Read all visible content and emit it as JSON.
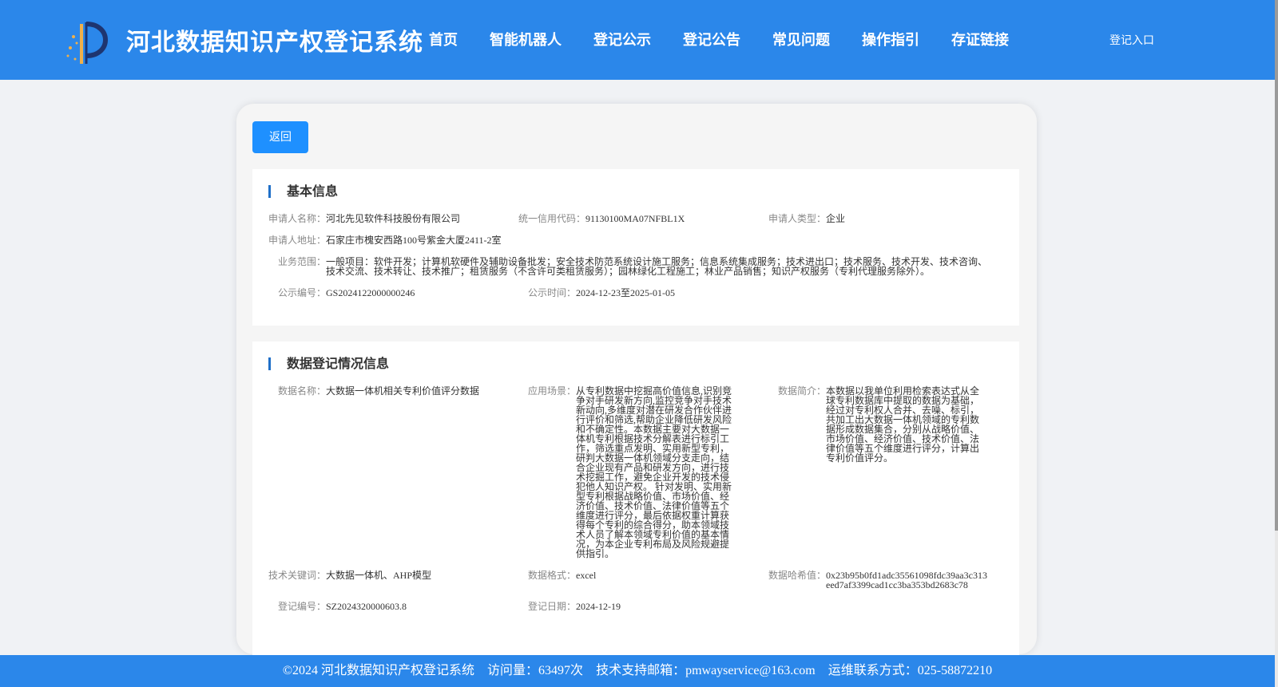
{
  "header": {
    "title": "河北数据知识产权登记系统",
    "nav": [
      "首页",
      "智能机器人",
      "登记公示",
      "登记公告",
      "常见问题",
      "操作指引",
      "存证链接"
    ],
    "login": "登记入口"
  },
  "back_label": "返回",
  "basic": {
    "title": "基本信息",
    "applicant_name_label": "申请人名称：",
    "applicant_name": "河北先见软件科技股份有限公司",
    "credit_code_label": "统一信用代码：",
    "credit_code": "91130100MA07NFBL1X",
    "applicant_type_label": "申请人类型：",
    "applicant_type": "企业",
    "address_label": "申请人地址：",
    "address": "石家庄市槐安西路100号紫金大厦2411-2室",
    "scope_label": "业务范围：",
    "scope": "一般项目：软件开发；计算机软硬件及辅助设备批发；安全技术防范系统设计施工服务；信息系统集成服务；技术进出口；技术服务、技术开发、技术咨询、技术交流、技术转让、技术推广；租赁服务（不含许可类租赁服务）；园林绿化工程施工；林业产品销售；知识产权服务（专利代理服务除外）。",
    "notice_no_label": "公示编号：",
    "notice_no": "GS2024122000000246",
    "notice_time_label": "公示时间：",
    "notice_time": "2024-12-23至2025-01-05"
  },
  "registration": {
    "title": "数据登记情况信息",
    "data_name_label": "数据名称：",
    "data_name": "大数据一体机相关专利价值评分数据",
    "scenario_label": "应用场景：",
    "scenario": "从专利数据中挖掘高价值信息,识别竞争对手研发新方向,监控竞争对手技术新动向,多维度对潜在研发合作伙伴进行评价和筛选,帮助企业降低研发风险和不确定性。本数据主要对大数据一体机专利根据技术分解表进行标引工作，筛选重点发明、实用新型专利，研判大数据一体机领域分支走向，结合企业现有产品和研发方向，进行技术挖掘工作，避免企业开发的技术侵犯他人知识产权。 针对发明、实用新型专利根据战略价值、市场价值、经济价值、技术价值、法律价值等五个维度进行评分，最后依据权重计算获得每个专利的综合得分，助本领域技术人员了解本领域专利价值的基本情况，为本企业专利布局及风险规避提供指引。",
    "intro_label": "数据简介：",
    "intro": "本数据以我单位利用检索表达式从全球专利数据库中提取的数据为基础，经过对专利权人合并、去噪、标引，共加工出大数据一体机领域的专利数据形成数据集合，分别从战略价值、市场价值、经济价值、技术价值、法律价值等五个维度进行评分，计算出专利价值评分。",
    "keywords_label": "技术关键词：",
    "keywords": "大数据一体机、AHP模型",
    "format_label": "数据格式：",
    "format": "excel",
    "hash_label": "数据哈希值：",
    "hash": "0x23b95b0fd1adc35561098fdc39aa3c313eed7af3399cad1cc3ba353bd2683c78",
    "reg_no_label": "登记编号：",
    "reg_no": "SZ2024320000603.8",
    "reg_date_label": "登记日期：",
    "reg_date": "2024-12-19"
  },
  "footer": {
    "copyright": "©2024 河北数据知识产权登记系统",
    "visits": "访问量：63497次",
    "email": "技术支持邮箱：pmwayservice@163.com",
    "phone": "运维联系方式：025-58872210"
  },
  "colors": {
    "primary": "#2b87ea",
    "button": "#1e90ff",
    "title_bar": "#1f6fc8"
  }
}
